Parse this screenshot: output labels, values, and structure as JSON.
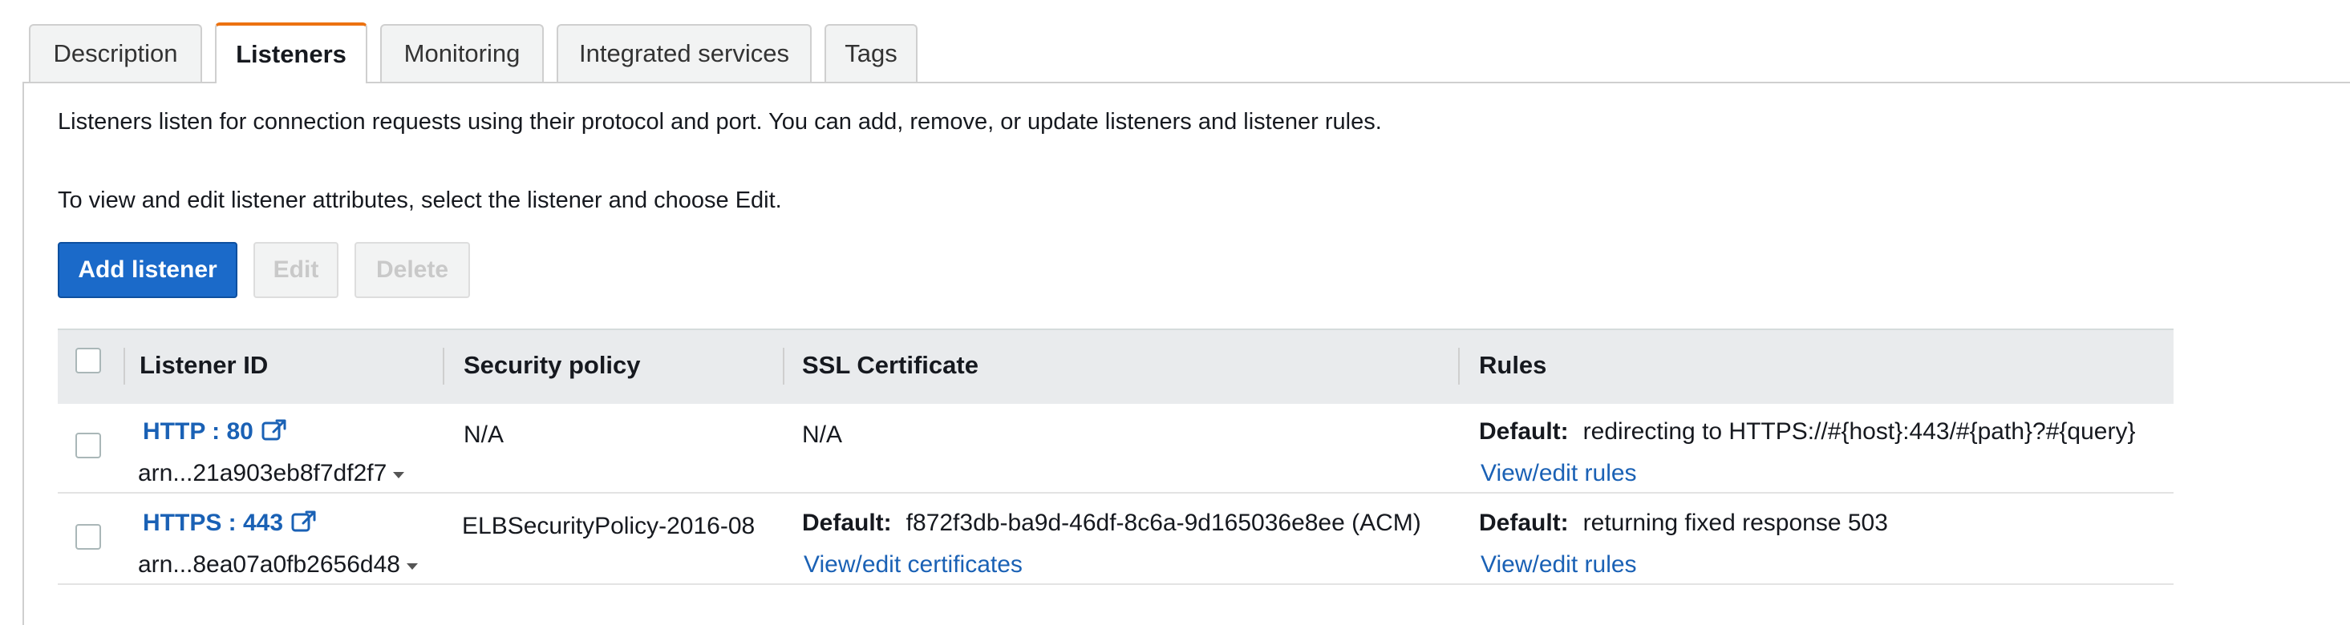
{
  "tabs": [
    {
      "label": "Description",
      "active": false
    },
    {
      "label": "Listeners",
      "active": true
    },
    {
      "label": "Monitoring",
      "active": false
    },
    {
      "label": "Integrated services",
      "active": false
    },
    {
      "label": "Tags",
      "active": false
    }
  ],
  "intro": {
    "line1": "Listeners listen for connection requests using their protocol and port. You can add, remove, or update listeners and listener rules.",
    "line2": "To view and edit listener attributes, select the listener and choose Edit."
  },
  "buttons": {
    "add": "Add listener",
    "edit": "Edit",
    "delete": "Delete"
  },
  "table": {
    "columns": [
      "Listener ID",
      "Security policy",
      "SSL Certificate",
      "Rules"
    ],
    "rows": [
      {
        "listener": "HTTP : 80",
        "arn": "arn...21a903eb8f7df2f7",
        "security_policy": "N/A",
        "ssl_certificate": "N/A",
        "ssl_default_label": "",
        "ssl_link": "",
        "rules_default_label": "Default:",
        "rules_default_value": "redirecting to HTTPS://#{host}:443/#{path}?#{query}",
        "rules_link": "View/edit rules"
      },
      {
        "listener": "HTTPS : 443",
        "arn": "arn...8ea07a0fb2656d48",
        "security_policy": "ELBSecurityPolicy-2016-08",
        "ssl_default_label": "Default:",
        "ssl_certificate": "f872f3db-ba9d-46df-8c6a-9d165036e8ee (ACM)",
        "ssl_link": "View/edit certificates",
        "rules_default_label": "Default:",
        "rules_default_value": "returning fixed response 503",
        "rules_link": "View/edit rules"
      }
    ]
  },
  "colors": {
    "accent_tab": "#ec7211",
    "primary_button": "#1b6ac9",
    "link": "#1a61b5"
  }
}
